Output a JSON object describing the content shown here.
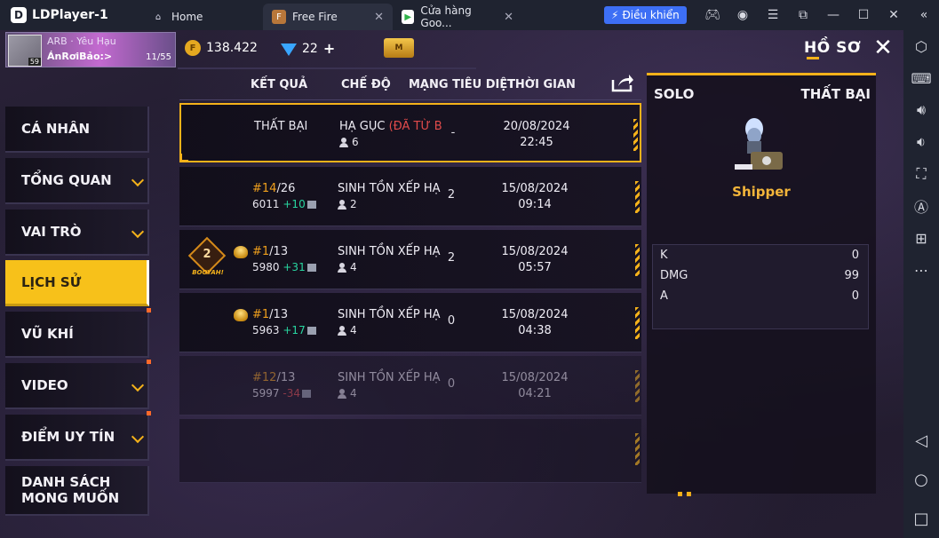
{
  "emulator": {
    "app_name": "LDPlayer-1",
    "tabs": [
      {
        "label": "Home"
      },
      {
        "label": "Free Fire"
      },
      {
        "label": "Cửa hàng Goo..."
      }
    ],
    "control_button": "Điều khiển"
  },
  "game": {
    "profile": {
      "guild": "ARB · Yêu Hạu",
      "name": "ÁnRơiBảo:>",
      "level": "59",
      "count": "11/55"
    },
    "gold": "138.422",
    "diamonds": "22",
    "page_title": "HỒ SƠ",
    "nav": [
      {
        "label": "CÁ NHÂN"
      },
      {
        "label": "TỔNG QUAN"
      },
      {
        "label": "VAI TRÒ"
      },
      {
        "label": "LỊCH SỬ"
      },
      {
        "label": "VŨ KHÍ"
      },
      {
        "label": "VIDEO"
      },
      {
        "label": "ĐIỂM UY TÍN"
      },
      {
        "label_line1": "DANH SÁCH",
        "label_line2": "MONG MUỐN"
      }
    ],
    "columns": {
      "result": "KẾT QUẢ",
      "mode": "CHẾ ĐỘ",
      "kills": "MẠNG TIÊU DIỆT",
      "time": "THỜI GIAN"
    },
    "matches": [
      {
        "result": "THẤT BẠI",
        "rank": "",
        "total": "",
        "score": "",
        "delta": "",
        "mode": "HẠ GỤC ",
        "mode_extra": "(ĐÃ TỪ B",
        "players": "6",
        "kills": "-",
        "date": "20/08/2024",
        "time": "22:45"
      },
      {
        "result": "",
        "rank": "#14",
        "total": "/26",
        "score": "6011",
        "delta": "+10",
        "mode": "SINH TỒN XẾP HẠ",
        "mode_extra": "",
        "players": "2",
        "kills": "2",
        "date": "15/08/2024",
        "time": "09:14"
      },
      {
        "result": "",
        "rank": "#1",
        "total": "/13",
        "score": "5980",
        "delta": "+31",
        "mode": "SINH TỒN XẾP HẠ",
        "mode_extra": "",
        "players": "4",
        "kills": "2",
        "date": "15/08/2024",
        "time": "05:57",
        "booyah_count": "2",
        "booyah_text": "BOOYAH!"
      },
      {
        "result": "",
        "rank": "#1",
        "total": "/13",
        "score": "5963",
        "delta": "+17",
        "mode": "SINH TỒN XẾP HẠ",
        "mode_extra": "",
        "players": "4",
        "kills": "0",
        "date": "15/08/2024",
        "time": "04:38"
      },
      {
        "result": "",
        "rank": "#12",
        "total": "/13",
        "score": "5997",
        "delta": "-34",
        "mode": "SINH TỒN XẾP HẠ",
        "mode_extra": "",
        "players": "4",
        "kills": "0",
        "date": "15/08/2024",
        "time": "04:21"
      }
    ],
    "detail": {
      "mode": "SOLO",
      "result": "THẤT BẠI",
      "character": "Shipper",
      "stats": [
        {
          "label": "K",
          "value": "0"
        },
        {
          "label": "DMG",
          "value": "99"
        },
        {
          "label": "A",
          "value": "0"
        }
      ]
    }
  }
}
